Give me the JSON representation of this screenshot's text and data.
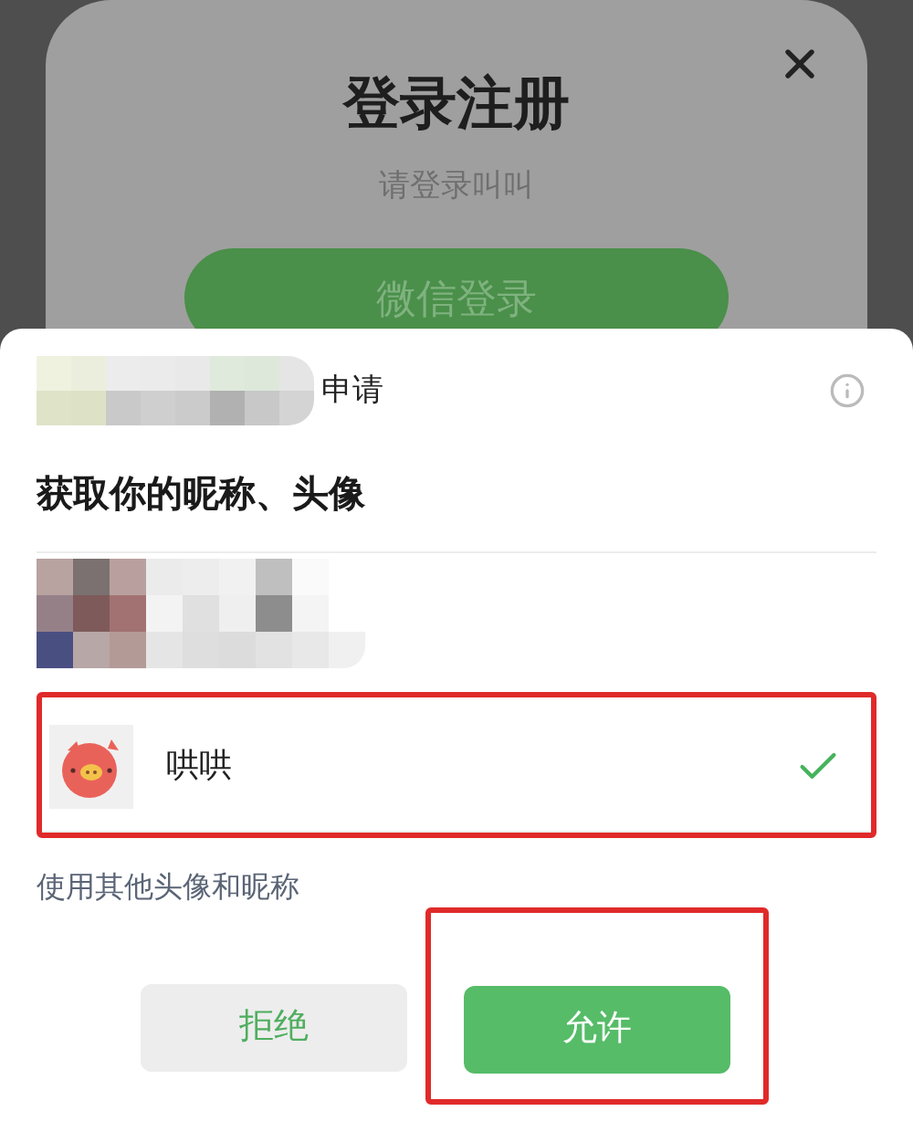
{
  "background_dialog": {
    "title": "登录注册",
    "subtitle": "请登录叫叫",
    "button": "微信登录"
  },
  "sheet": {
    "header": {
      "suffix": "申请"
    },
    "permission": "获取你的昵称、头像",
    "profiles": [
      {
        "kind": "picture",
        "selected": false,
        "highlighted": false
      },
      {
        "kind": "avatar",
        "name": "哄哄",
        "selected": true,
        "highlighted": true
      }
    ],
    "other_link": "使用其他头像和昵称",
    "buttons": [
      {
        "label": "拒绝",
        "kind": "secondary",
        "highlighted": false
      },
      {
        "label": "允许",
        "kind": "primary",
        "highlighted": true
      }
    ]
  }
}
